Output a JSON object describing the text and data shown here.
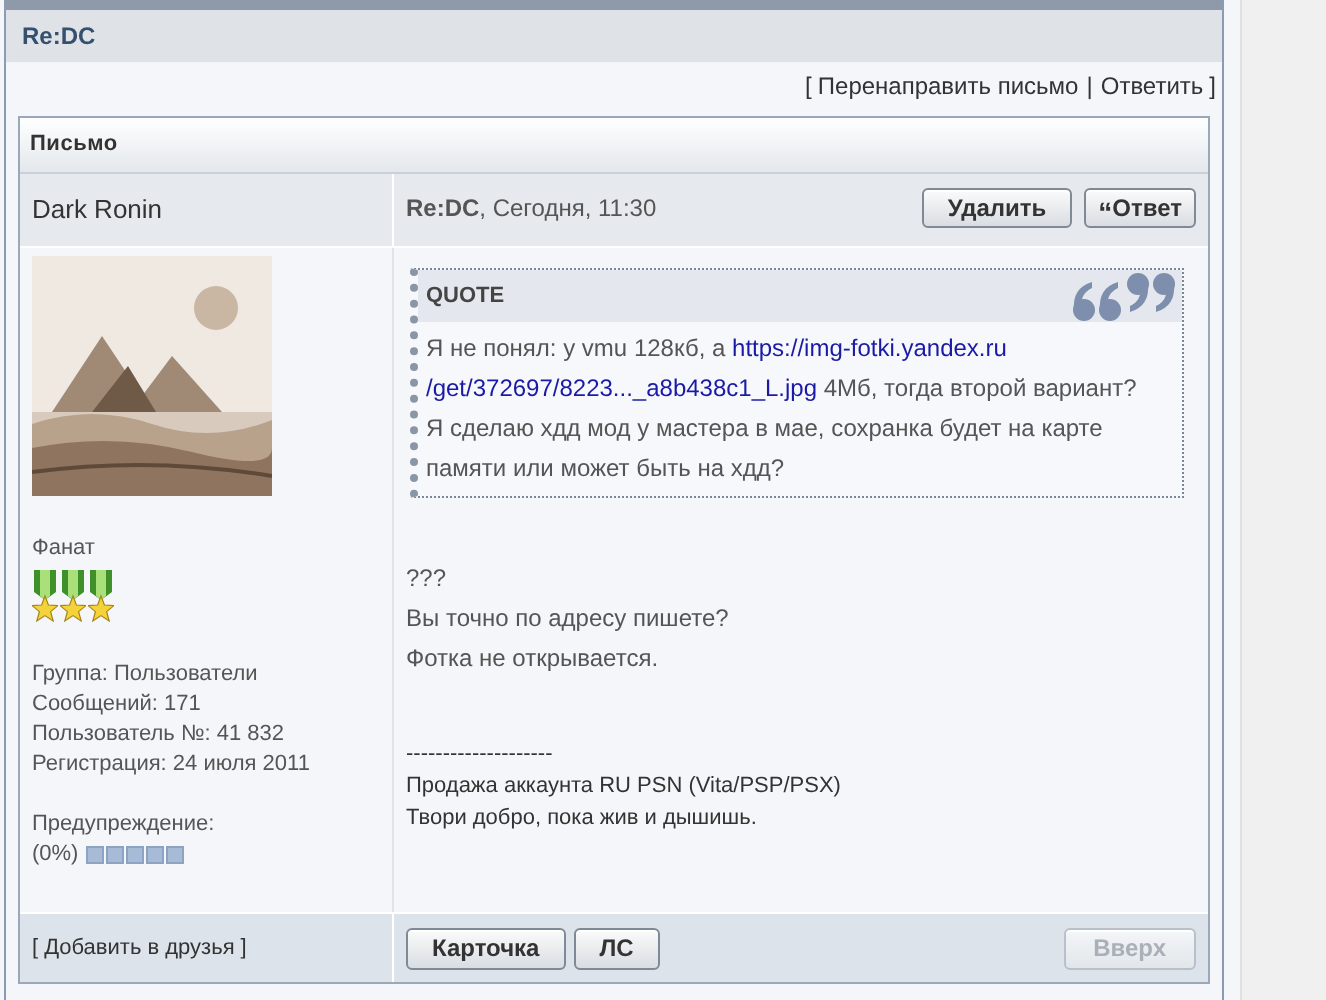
{
  "page_title": "Re:DC",
  "actions_open": "[",
  "actions": [
    {
      "label": "Перенаправить письмо"
    },
    {
      "label": "Ответить"
    }
  ],
  "actions_separator": "|",
  "actions_close": "]",
  "box_title": "Письмо",
  "author": {
    "name": "Dark Ronin",
    "avatar": {
      "kind": "picture"
    },
    "rank": "Фанат",
    "rank_badges": [
      {
        "kind": "medal"
      },
      {
        "kind": "medal"
      },
      {
        "kind": "medal"
      }
    ],
    "info": [
      "Группа: Пользователи",
      "Сообщений: 171",
      "Пользователь №: 41 832",
      "Регистрация: 24 июля 2011"
    ],
    "warning_label": "Предупреждение:",
    "warning_value": "(0%)",
    "add_friend_open": "[",
    "add_friend": "Добавить в друзья",
    "add_friend_close": "]"
  },
  "post": {
    "header": "**Re:DC**, Сегодня, 11:30",
    "header_buttons": [
      {
        "label": "Удалить",
        "disabled": false
      },
      {
        "icon": "“",
        "label": "Ответ",
        "disabled": false
      }
    ],
    "quote": {
      "title": "QUOTE",
      "paragraphs": [
        [
          {
            "kind": "text",
            "text": "Я не понял: у vmu 128кб, а "
          },
          {
            "kind": "link",
            "text": "https://img-fotki.yandex.ru"
          },
          {
            "kind": "break"
          },
          {
            "kind": "link",
            "text": "/get/372697/8223..._a8b438c1_L.jpg"
          },
          {
            "kind": "text",
            "text": " 4Мб, тогда второй вариант?"
          }
        ],
        [
          {
            "kind": "text",
            "text": "Я сделаю хдд мод у мастера в мае, сохранка будет на карте памяти или может быть на хдд?"
          }
        ]
      ]
    },
    "lines": [
      "???",
      "Вы точно по адресу пишете?",
      "Фотка не открывается."
    ],
    "signature": [
      "--------------------",
      "Продажа аккаунта RU PSN (Vita/PSP/PSX)",
      "Твори добро, пока жив и дышишь."
    ],
    "footer_buttons": [
      {
        "label": "Карточка",
        "disabled": false
      },
      {
        "label": "ЛС",
        "disabled": false
      },
      {
        "label": "Вверх",
        "disabled": true
      }
    ]
  }
}
